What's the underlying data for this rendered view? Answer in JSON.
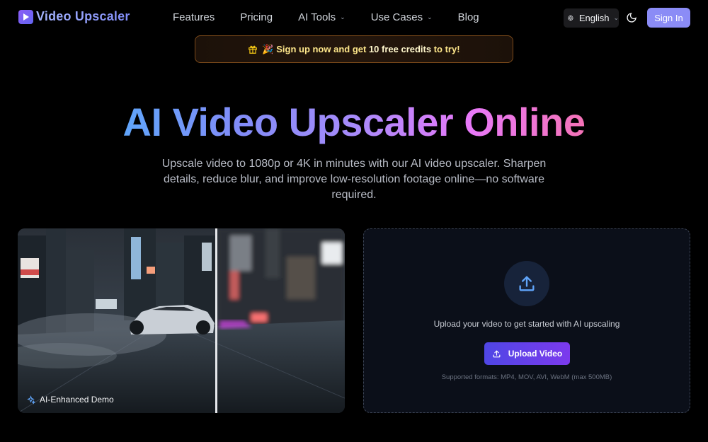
{
  "brand": {
    "name": "Video Upscaler"
  },
  "nav": {
    "links": [
      {
        "label": "Features",
        "dropdown": false
      },
      {
        "label": "Pricing",
        "dropdown": false
      },
      {
        "label": "AI Tools",
        "dropdown": true
      },
      {
        "label": "Use Cases",
        "dropdown": true
      },
      {
        "label": "Blog",
        "dropdown": false
      }
    ],
    "language": "English",
    "sign_in": "Sign In"
  },
  "promo": {
    "prefix": "🎉 Sign up now and get ",
    "highlight": "10 free credits",
    "suffix": " to try!"
  },
  "hero": {
    "title": "AI Video Upscaler Online",
    "subtitle": "Upscale video to 1080p or 4K in minutes with our AI video upscaler. Sharpen details, reduce blur, and improve low-resolution footage online—no software required."
  },
  "demo": {
    "label": "AI-Enhanced Demo"
  },
  "upload": {
    "prompt": "Upload your video to get started with AI upscaling",
    "button": "Upload Video",
    "formats": "Supported formats: MP4, MOV, AVI, WebM (max 500MB)"
  },
  "colors": {
    "accent": "#8b8cf6",
    "upload_button": "#5b3ff0",
    "promo_border": "#7c4a1a"
  }
}
